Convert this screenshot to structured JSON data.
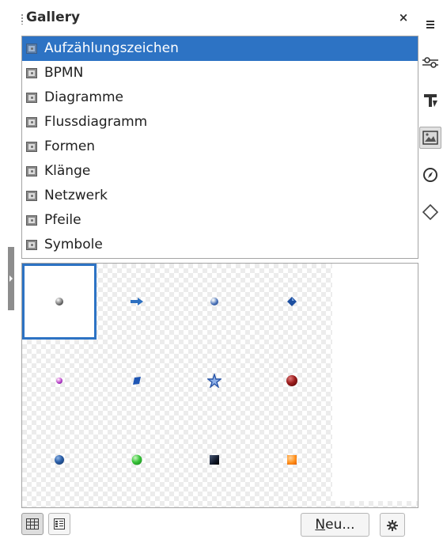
{
  "deck": {
    "title": "Gallery",
    "close_label": "×"
  },
  "themes": [
    {
      "label": "Aufzählungszeichen",
      "selected": true
    },
    {
      "label": "BPMN",
      "selected": false
    },
    {
      "label": "Diagramme",
      "selected": false
    },
    {
      "label": "Flussdiagramm",
      "selected": false
    },
    {
      "label": "Formen",
      "selected": false
    },
    {
      "label": "Klänge",
      "selected": false
    },
    {
      "label": "Netzwerk",
      "selected": false
    },
    {
      "label": "Pfeile",
      "selected": false
    },
    {
      "label": "Symbole",
      "selected": false
    }
  ],
  "preview": {
    "items": [
      {
        "icon": "gray-ball-bullet-icon",
        "selected": true
      },
      {
        "icon": "blue-arrow-bullet-icon"
      },
      {
        "icon": "blue-ball-bullet-icon"
      },
      {
        "icon": "blue-diamond-bullet-icon"
      },
      {
        "icon": "purple-ball-bullet-icon"
      },
      {
        "icon": "blue-square-bullet-icon"
      },
      {
        "icon": "blue-star-bullet-icon"
      },
      {
        "icon": "dark-red-ball-bullet-icon"
      },
      {
        "icon": "dark-blue-ball-bullet-icon"
      },
      {
        "icon": "green-ball-bullet-icon"
      },
      {
        "icon": "black-square-bullet-icon"
      },
      {
        "icon": "orange-square-bullet-icon"
      }
    ]
  },
  "toolbar": {
    "new_label_mnemonic": "N",
    "new_label_rest": "eu...",
    "icon_view": "icon-view-icon",
    "detail_view": "detail-view-icon",
    "settings": "gear-icon"
  },
  "tabbar": {
    "items": [
      "menu-icon",
      "properties-icon",
      "styles-icon",
      "gallery-icon",
      "navigator-icon",
      "shapes-icon"
    ],
    "active": "gallery-icon"
  },
  "colors": {
    "selection": "#2d73c4",
    "text": "#202020"
  }
}
